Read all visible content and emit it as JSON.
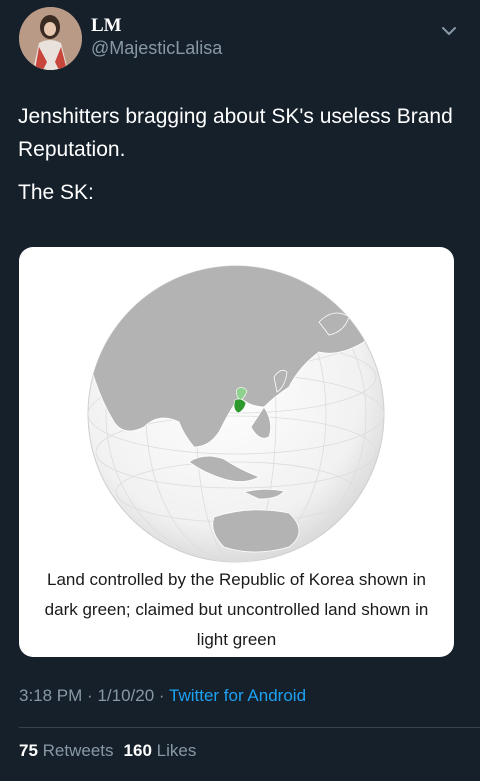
{
  "author": {
    "name": "LM",
    "handle": "@MajesticLalisa"
  },
  "icons": {
    "more": "chevron-down-icon",
    "avatar": "profile-photo"
  },
  "tweet": {
    "text_line1": "Jenshitters bragging about SK's useless Brand Reputation.",
    "text_line2": "The SK:",
    "media_caption": "Land controlled by the Republic of Korea shown in dark green; claimed but uncontrolled land shown in light green"
  },
  "meta": {
    "time": "3:18 PM",
    "separator": "·",
    "date": "1/10/20",
    "source": "Twitter for Android"
  },
  "stats": {
    "retweets_count": "75",
    "retweets_label": "Retweets",
    "likes_count": "160",
    "likes_label": "Likes"
  },
  "colors": {
    "background": "#15202b",
    "secondary_text": "#8899a6",
    "link": "#1da1f2",
    "korea_dark_green": "#2e9a2e",
    "korea_light_green": "#8fd18f"
  }
}
